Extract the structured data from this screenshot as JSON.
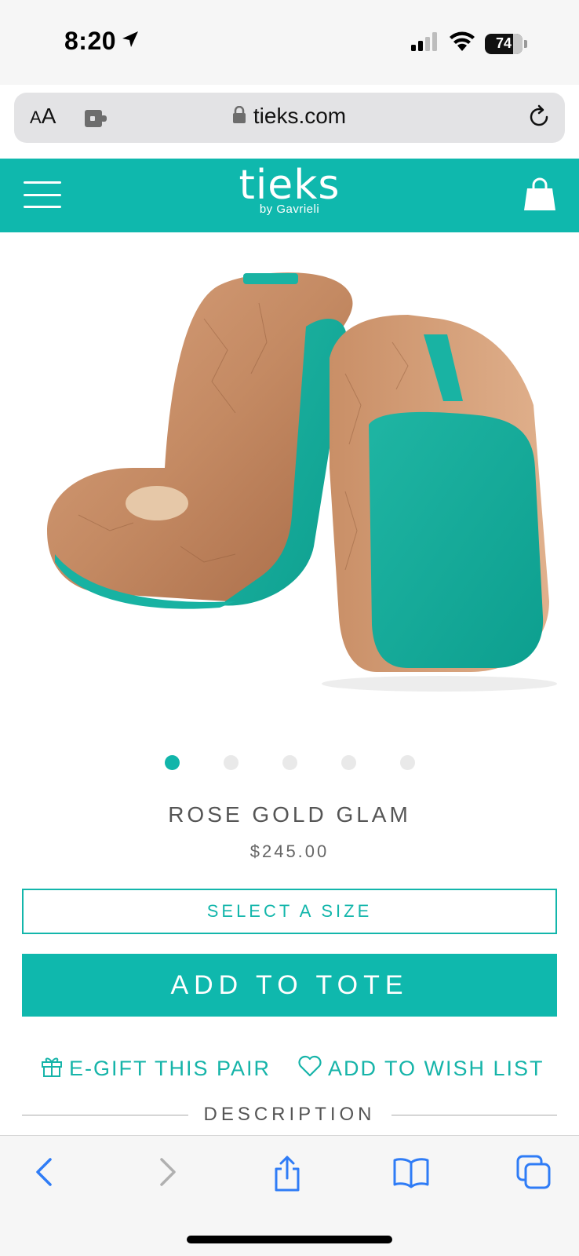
{
  "status_bar": {
    "time": "8:20",
    "battery": "74"
  },
  "browser": {
    "text_size_label_small": "A",
    "text_size_label_large": "A",
    "url": "tieks.com"
  },
  "header": {
    "logo": "tieks",
    "logo_sub": "by Gavrieli"
  },
  "product": {
    "name": "ROSE GOLD GLAM",
    "price": "$245.00",
    "image_count": 5,
    "active_image_index": 0,
    "select_size_label": "SELECT A SIZE",
    "add_to_tote_label": "ADD TO TOTE",
    "egift_label": "E-GIFT THIS PAIR",
    "wishlist_label": "ADD TO WISH LIST",
    "description_label": "DESCRIPTION"
  },
  "colors": {
    "brand_teal": "#0fb8ad",
    "text_gray": "#555555",
    "ios_blue": "#2f7cf6"
  },
  "icons": {
    "status": [
      "location-arrow-icon",
      "signal-icon",
      "wifi-icon",
      "battery-icon"
    ],
    "url_bar": [
      "extension-icon",
      "lock-icon",
      "reload-icon"
    ],
    "header": [
      "hamburger-menu-icon",
      "shopping-bag-icon"
    ],
    "actions": [
      "gift-icon",
      "heart-icon"
    ],
    "toolbar": [
      "back-icon",
      "forward-icon",
      "share-icon",
      "bookmarks-icon",
      "tabs-icon"
    ]
  }
}
